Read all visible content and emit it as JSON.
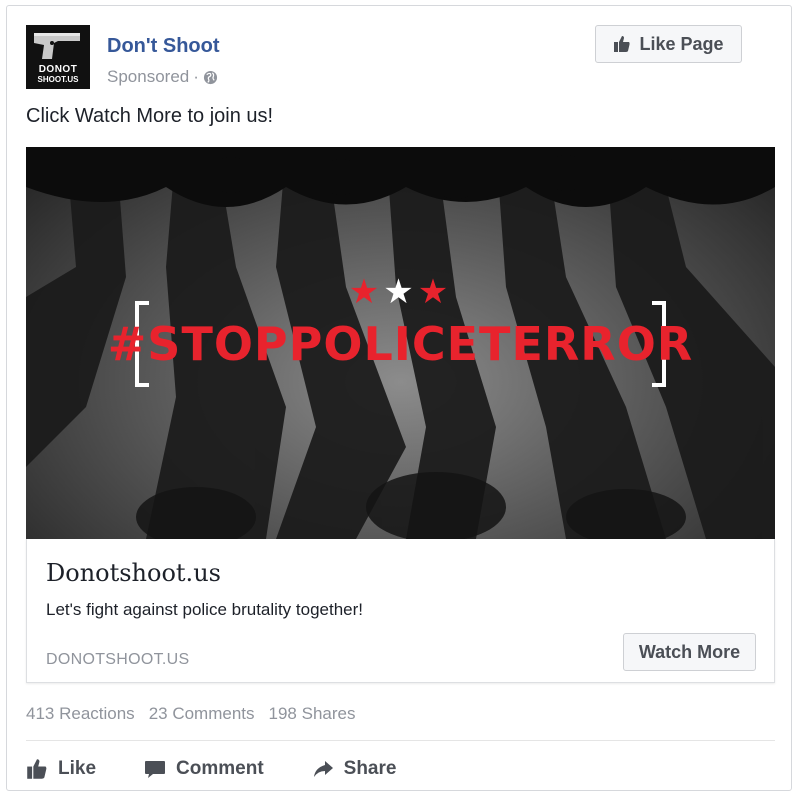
{
  "post": {
    "page_name": "Don't Shoot",
    "sponsored_label": "Sponsored",
    "separator": "·",
    "avatar_text_line1": "DONOT",
    "avatar_text_line2": "SHOOT.US",
    "like_page_label": "Like Page",
    "text": "Click Watch More to join us!"
  },
  "hero": {
    "hashtag": "#STOPPOLICETERROR",
    "stars": [
      "★",
      "★",
      "★"
    ],
    "star_colors": [
      "#e8232d",
      "#ffffff",
      "#e8232d"
    ]
  },
  "link": {
    "title": "Donotshoot.us",
    "description": "Let's fight against police brutality together!",
    "domain": "DONOTSHOOT.US",
    "cta_label": "Watch More"
  },
  "stats": {
    "reactions": "413 Reactions",
    "comments": "23 Comments",
    "shares": "198 Shares"
  },
  "actions": {
    "like": "Like",
    "comment": "Comment",
    "share": "Share"
  },
  "icons": {
    "thumbs_up": "thumbs-up-icon",
    "globe": "globe-icon",
    "comment": "comment-icon",
    "share": "share-arrow-icon"
  },
  "colors": {
    "brand_link": "#365899",
    "muted": "#90949c",
    "accent_red": "#e8232d"
  }
}
